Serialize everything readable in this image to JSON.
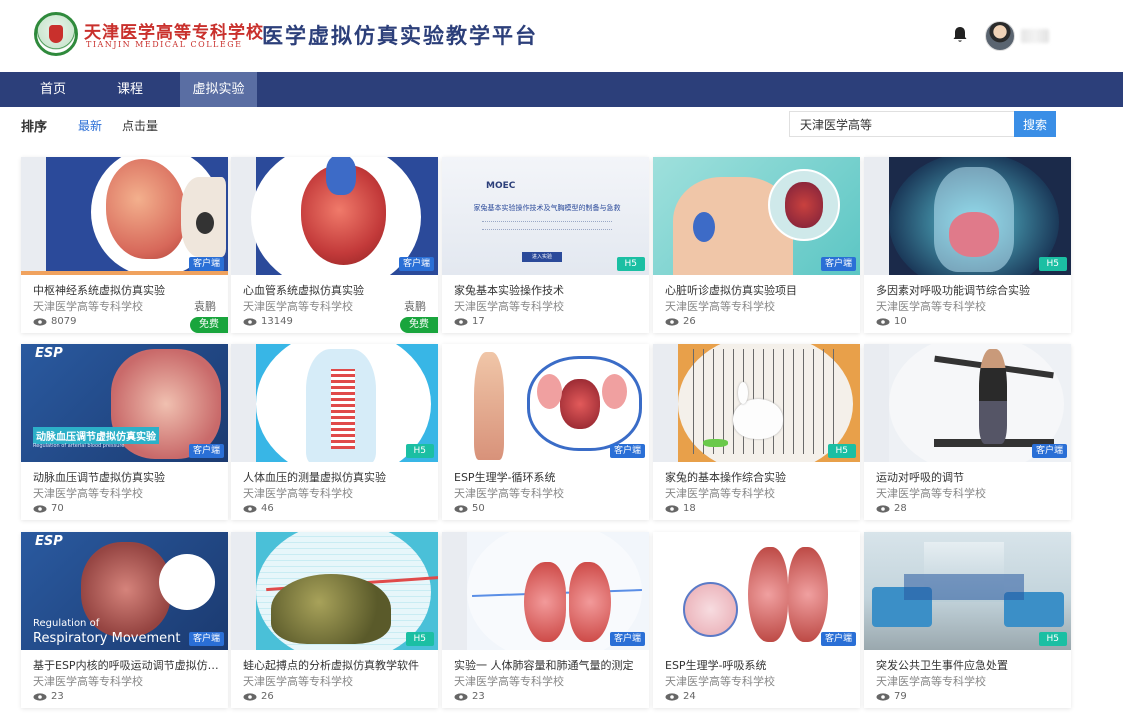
{
  "header": {
    "school_cn": "天津医学高等专科学校",
    "school_en": "TIANJIN MEDICAL COLLEGE",
    "platform_title": "医学虚拟仿真实验教学平台"
  },
  "nav": {
    "items": [
      {
        "label": "首页"
      },
      {
        "label": "课程"
      },
      {
        "label": "虚拟实验"
      }
    ]
  },
  "sort": {
    "label": "排序",
    "options": [
      {
        "label": "最新"
      },
      {
        "label": "点击量"
      }
    ]
  },
  "search": {
    "value": "天津医学高等",
    "button": "搜索"
  },
  "colors": {
    "brand_blue": "#2c3f7a",
    "nav_active": "#5a6ea3",
    "client_badge": "#2a6fd6",
    "h5_badge": "#1bbfa3",
    "free_badge": "#19a53d",
    "school_red": "#c9302c"
  },
  "cards": [
    {
      "title": "中枢神经系统虚拟仿真实验",
      "school": "天津医学高等专科学校",
      "author": "袁鹏",
      "views": "8079",
      "badge": "客户端",
      "free": "免费"
    },
    {
      "title": "心血管系统虚拟仿真实验",
      "school": "天津医学高等专科学校",
      "author": "袁鹏",
      "views": "13149",
      "badge": "客户端",
      "free": "免费"
    },
    {
      "title": "家兔基本实验操作技术",
      "school": "天津医学高等专科学校",
      "views": "17",
      "badge": "H5",
      "thumb_text": {
        "brand": "MOEC",
        "title": "家兔基本实验操作技术及气胸模型的制备与急救",
        "button": "进入实验"
      }
    },
    {
      "title": "心脏听诊虚拟仿真实验项目",
      "school": "天津医学高等专科学校",
      "views": "26",
      "badge": "客户端"
    },
    {
      "title": "多因素对呼吸功能调节综合实验",
      "school": "天津医学高等专科学校",
      "views": "10",
      "badge": "H5"
    },
    {
      "title": "动脉血压调节虚拟仿真实验",
      "school": "天津医学高等专科学校",
      "views": "70",
      "badge": "客户端",
      "thumb_text": {
        "brand": "ESP",
        "title": "动脉血压调节虚拟仿真实验",
        "subtitle": "Regulation of arterial blood pressure"
      }
    },
    {
      "title": "人体血压的测量虚拟仿真实验",
      "school": "天津医学高等专科学校",
      "views": "46",
      "badge": "H5"
    },
    {
      "title": "ESP生理学-循环系统",
      "school": "天津医学高等专科学校",
      "views": "50",
      "badge": "客户端"
    },
    {
      "title": "家兔的基本操作综合实验",
      "school": "天津医学高等专科学校",
      "views": "18",
      "badge": "H5"
    },
    {
      "title": "运动对呼吸的调节",
      "school": "天津医学高等专科学校",
      "views": "28",
      "badge": "客户端"
    },
    {
      "title": "基于ESP内核的呼吸运动调节虚拟仿真实验",
      "school": "天津医学高等专科学校",
      "views": "23",
      "badge": "客户端",
      "thumb_text": {
        "brand": "ESP",
        "title": "Regulation of",
        "subtitle": "Respiratory Movement"
      }
    },
    {
      "title": "蛙心起搏点的分析虚拟仿真教学软件",
      "school": "天津医学高等专科学校",
      "views": "26",
      "badge": "H5"
    },
    {
      "title": "实验一 人体肺容量和肺通气量的测定",
      "school": "天津医学高等专科学校",
      "views": "23",
      "badge": "客户端"
    },
    {
      "title": "ESP生理学-呼吸系统",
      "school": "天津医学高等专科学校",
      "views": "24",
      "badge": "客户端"
    },
    {
      "title": "突发公共卫生事件应急处置",
      "school": "天津医学高等专科学校",
      "views": "79",
      "badge": "H5"
    }
  ]
}
